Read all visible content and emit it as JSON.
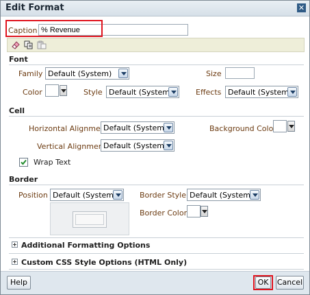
{
  "dialog": {
    "title": "Edit Format"
  },
  "caption": {
    "label": "Caption",
    "value": "% Revenue"
  },
  "font": {
    "section": "Font",
    "family_label": "Family",
    "family_value": "Default (System)",
    "size_label": "Size",
    "size_value": "",
    "color_label": "Color",
    "style_label": "Style",
    "style_value": "Default (System)",
    "effects_label": "Effects",
    "effects_value": "Default (System)"
  },
  "cell": {
    "section": "Cell",
    "halign_label": "Horizontal Alignment",
    "halign_value": "Default (System)",
    "bgcolor_label": "Background Color",
    "valign_label": "Vertical Alignment",
    "valign_value": "Default (System)",
    "wrap_label": "Wrap Text",
    "wrap_checked": true
  },
  "border": {
    "section": "Border",
    "position_label": "Position",
    "position_value": "Default (System)",
    "style_label": "Border Style",
    "style_value": "Default (System)",
    "color_label": "Border Color"
  },
  "sections": {
    "additional": "Additional Formatting Options",
    "custom_css": "Custom CSS Style Options (HTML Only)"
  },
  "footer": {
    "help": "Help",
    "ok": "OK",
    "cancel": "Cancel"
  },
  "colors": {
    "highlight": "#e0141e",
    "title_bar": "#d6e0e8",
    "footer": "#dfe7ee",
    "toolbar": "#eeeed9"
  }
}
